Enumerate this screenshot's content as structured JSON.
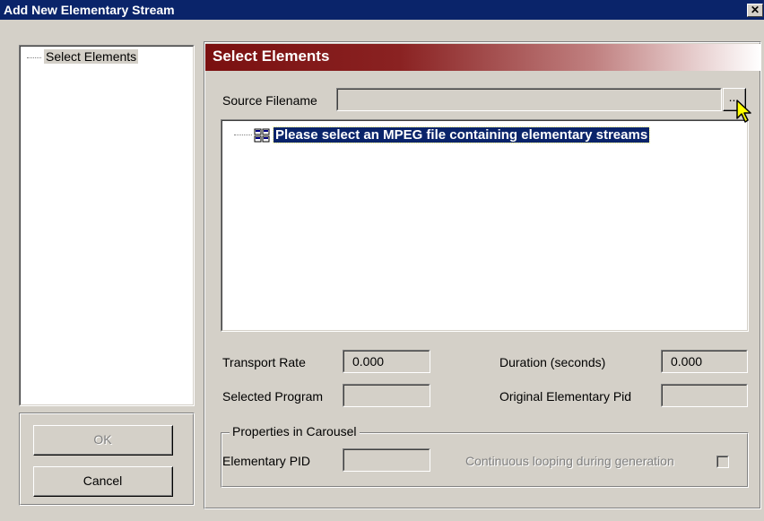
{
  "window": {
    "title": "Add New Elementary Stream",
    "close_glyph": "✕"
  },
  "tree": {
    "items": [
      {
        "label": "Select Elements"
      }
    ]
  },
  "buttons": {
    "ok_label": "OK",
    "cancel_label": "Cancel"
  },
  "panel": {
    "header": "Select Elements",
    "source_filename_label": "Source Filename",
    "source_filename_value": "",
    "browse_label": "...",
    "stream_list": {
      "items": [
        {
          "label": "Please select an MPEG file containing elementary streams",
          "icon": "grid-icon"
        }
      ]
    },
    "transport_rate_label": "Transport Rate",
    "transport_rate_value": "0.000",
    "duration_label": "Duration (seconds)",
    "duration_value": "0.000",
    "selected_program_label": "Selected Program",
    "selected_program_value": "",
    "original_pid_label": "Original Elementary Pid",
    "original_pid_value": "",
    "carousel": {
      "title": "Properties in Carousel",
      "elementary_pid_label": "Elementary PID",
      "elementary_pid_value": "",
      "looping_label": "Continuous looping during generation",
      "looping_checked": false
    }
  },
  "colors": {
    "titlebar": "#0a246a",
    "header_gradient_start": "#7a1010",
    "face": "#d4d0c8",
    "selection": "#0a246a"
  }
}
